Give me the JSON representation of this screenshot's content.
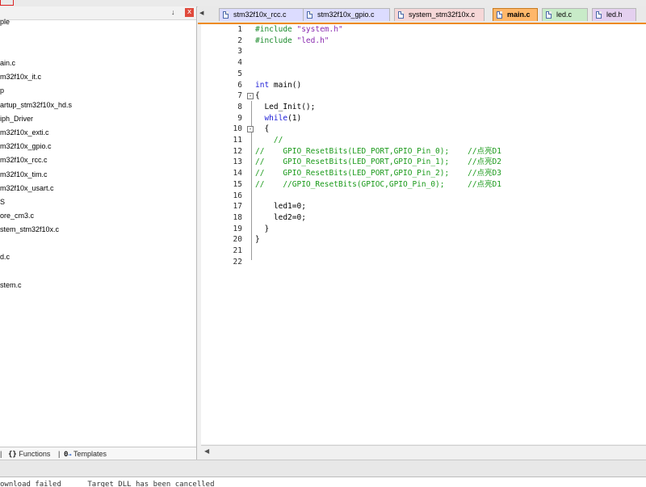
{
  "project_tree": {
    "items": [
      {
        "label": "ple"
      },
      {
        "label": "ain.c"
      },
      {
        "label": "m32f10x_it.c"
      },
      {
        "label": "p"
      },
      {
        "label": "artup_stm32f10x_hd.s"
      },
      {
        "label": "iph_Driver"
      },
      {
        "label": "m32f10x_exti.c"
      },
      {
        "label": "m32f10x_gpio.c"
      },
      {
        "label": "m32f10x_rcc.c"
      },
      {
        "label": "m32f10x_tim.c"
      },
      {
        "label": "m32f10x_usart.c"
      },
      {
        "label": "S"
      },
      {
        "label": "ore_cm3.c"
      },
      {
        "label": "stem_stm32f10x.c"
      },
      {
        "label": "d.c"
      },
      {
        "label": "stem.c"
      }
    ],
    "bottom_tabs": [
      {
        "glyph": "{}",
        "label": "Functions",
        "icon": "braces-icon"
      },
      {
        "glyph": "0",
        "label": "Templates",
        "icon": "templates-icon"
      }
    ],
    "pin_glyph": "↓",
    "close_glyph": "x"
  },
  "file_tabs": [
    {
      "label": "stm32f10x_rcc.c",
      "color": "#dcdcff",
      "active": false
    },
    {
      "label": "stm32f10x_gpio.c",
      "color": "#dcdcff",
      "active": false
    },
    {
      "label": "system_stm32f10x.c",
      "color": "#f6d7d7",
      "active": false
    },
    {
      "label": "main.c",
      "color": "#ffb76a",
      "active": true
    },
    {
      "label": "led.c",
      "color": "#c8ebc8",
      "active": false
    },
    {
      "label": "led.h",
      "color": "#e4d0ef",
      "active": false
    }
  ],
  "tab_scroll_glyph": "◀",
  "editor": {
    "line_numbers": [
      "1",
      "2",
      "3",
      "4",
      "5",
      "6",
      "7",
      "8",
      "9",
      "10",
      "11",
      "12",
      "13",
      "14",
      "15",
      "16",
      "17",
      "18",
      "19",
      "20",
      "21",
      "22"
    ],
    "lines": [
      [
        {
          "t": "#include ",
          "c": "pre"
        },
        {
          "t": "\"system.h\"",
          "c": "str"
        }
      ],
      [
        {
          "t": "#include ",
          "c": "pre"
        },
        {
          "t": "\"led.h\"",
          "c": "str"
        }
      ],
      [],
      [],
      [],
      [
        {
          "t": "int",
          "c": "kw"
        },
        {
          "t": " main()",
          "c": ""
        }
      ],
      [
        {
          "t": "{",
          "c": ""
        }
      ],
      [
        {
          "t": "  Led_Init();",
          "c": ""
        }
      ],
      [
        {
          "t": "  ",
          "c": ""
        },
        {
          "t": "while",
          "c": "kw"
        },
        {
          "t": "(1)",
          "c": ""
        }
      ],
      [
        {
          "t": "  {",
          "c": ""
        }
      ],
      [
        {
          "t": "    //",
          "c": "cmt"
        }
      ],
      [
        {
          "t": "//    GPIO_ResetBits(LED_PORT,GPIO_Pin_0);    //点亮D1",
          "c": "cmt"
        }
      ],
      [
        {
          "t": "//    GPIO_ResetBits(LED_PORT,GPIO_Pin_1);    //点亮D2",
          "c": "cmt"
        }
      ],
      [
        {
          "t": "//    GPIO_ResetBits(LED_PORT,GPIO_Pin_2);    //点亮D3",
          "c": "cmt"
        }
      ],
      [
        {
          "t": "//    //GPIO_ResetBits(GPIOC,GPIO_Pin_0);     //点亮D1",
          "c": "cmt"
        }
      ],
      [],
      [
        {
          "t": "    led1=0;",
          "c": ""
        }
      ],
      [
        {
          "t": "    led2=0;",
          "c": ""
        }
      ],
      [
        {
          "t": "  }",
          "c": ""
        }
      ],
      [
        {
          "t": "}",
          "c": ""
        }
      ],
      [],
      []
    ],
    "fold_markers": [
      {
        "line": 7,
        "glyph": "-"
      },
      {
        "line": 10,
        "glyph": "-"
      }
    ]
  },
  "hscroll_glyph": "◀",
  "build_output": {
    "text": "ownload failed      Target DLL has been cancelled"
  }
}
